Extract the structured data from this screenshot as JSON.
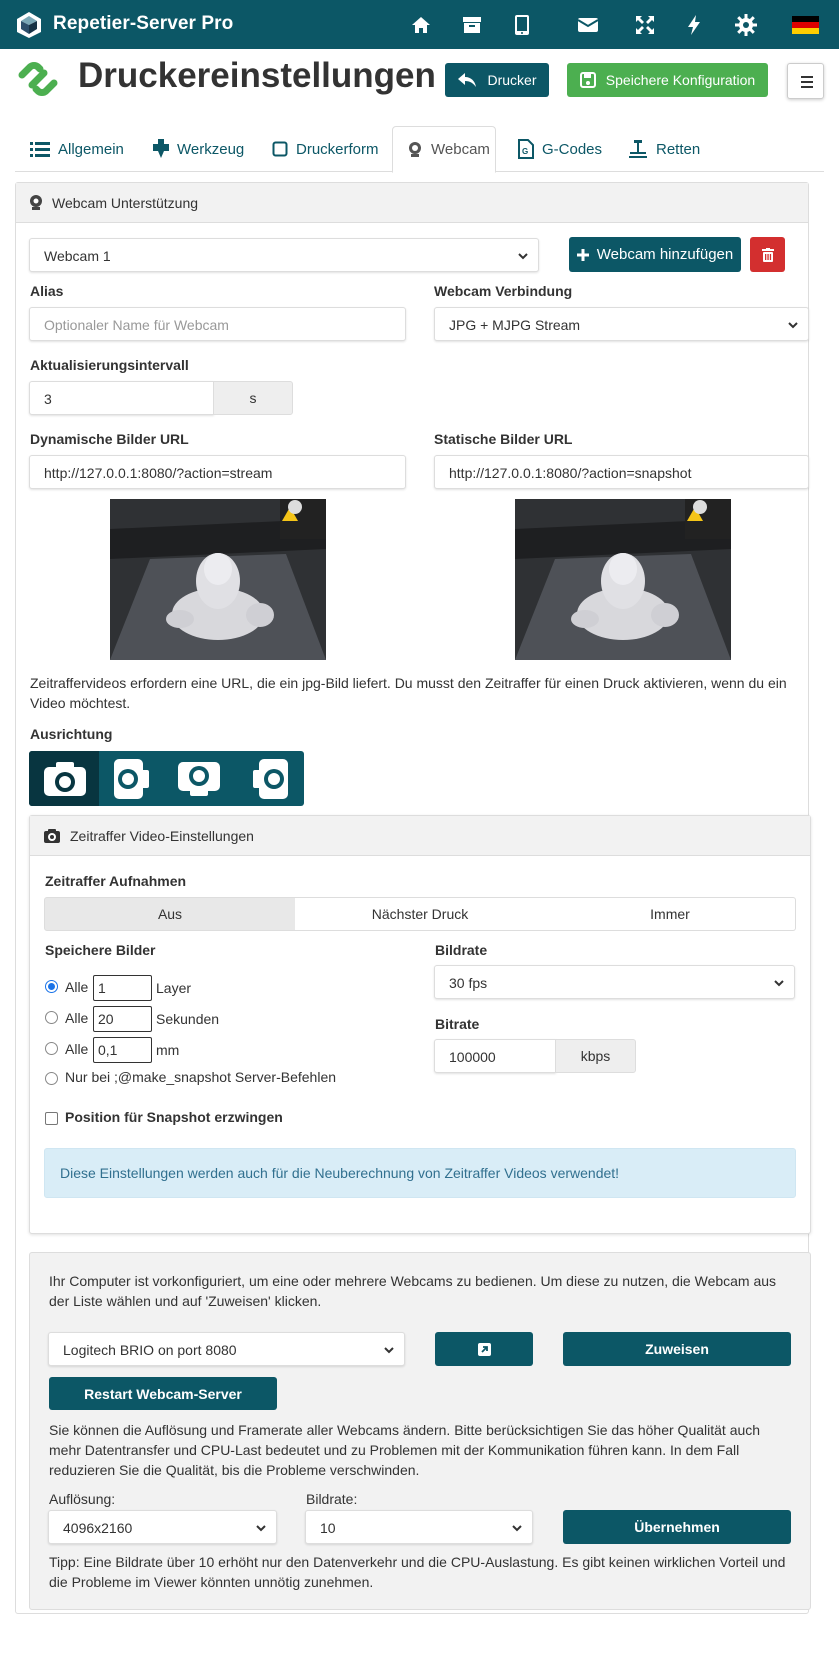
{
  "topbar": {
    "brand": "Repetier-Server Pro",
    "icons": [
      "home-icon",
      "archive-icon",
      "tablet-icon",
      "envelope-icon",
      "expand-icon",
      "bolt-icon",
      "gear-icon",
      "flag-de-icon"
    ],
    "color": "#0c5766"
  },
  "header": {
    "title": "Druckereinstellungen",
    "printer_button": "Drucker",
    "save_button": "Speichere Konfiguration"
  },
  "tabs": [
    {
      "label": "Allgemein",
      "icon": "list-icon"
    },
    {
      "label": "Werkzeug",
      "icon": "tool-icon"
    },
    {
      "label": "Druckerform",
      "icon": "square-icon"
    },
    {
      "label": "Webcam",
      "icon": "webcam-icon",
      "active": true
    },
    {
      "label": "G-Codes",
      "icon": "gcode-file-icon"
    },
    {
      "label": "Retten",
      "icon": "rescue-icon"
    }
  ],
  "webcam_panel": {
    "title": "Webcam Unterstützung",
    "webcam_select": "Webcam 1",
    "add_button": "Webcam hinzufügen",
    "alias_label": "Alias",
    "alias_placeholder": "Optionaler Name für Webcam",
    "connection_label": "Webcam Verbindung",
    "connection_value": "JPG + MJPG Stream",
    "interval_label": "Aktualisierungsintervall",
    "interval_value": "3",
    "interval_unit": "s",
    "dynamic_url_label": "Dynamische Bilder URL",
    "dynamic_url_value": "http://127.0.0.1:8080/?action=stream",
    "static_url_label": "Statische Bilder URL",
    "static_url_value": "http://127.0.0.1:8080/?action=snapshot",
    "timelapse_note": "Zeitraffervideos erfordern eine URL, die ein jpg-Bild liefert. Du musst den Zeitraffer für einen Druck aktivieren, wenn du ein Video möchtest.",
    "orientation_label": "Ausrichtung"
  },
  "timelapse": {
    "title": "Zeitraffer Video-Einstellungen",
    "captures_label": "Zeitraffer Aufnahmen",
    "options": [
      "Aus",
      "Nächster Druck",
      "Immer"
    ],
    "selected": "Aus",
    "save_images_label": "Speichere Bilder",
    "radio_prefix": "Alle",
    "every_layer_value": "1",
    "every_layer_unit": "Layer",
    "every_seconds_value": "20",
    "every_seconds_unit": "Sekunden",
    "every_mm_value": "0,1",
    "every_mm_unit": "mm",
    "only_on_label": "Nur bei ;@make_snapshot Server-Befehlen",
    "force_position_label": "Position für Snapshot erzwingen",
    "framerate_label": "Bildrate",
    "framerate_value": "30 fps",
    "bitrate_label": "Bitrate",
    "bitrate_value": "100000",
    "bitrate_unit": "kbps",
    "info": "Diese Einstellungen werden auch für die Neuberechnung von Zeitraffer Videos verwendet!"
  },
  "server_webcam": {
    "intro": "Ihr Computer ist vorkonfiguriert, um eine oder mehrere Webcams zu bedienen. Um diese zu nutzen, die Webcam aus der Liste wählen und auf 'Zuweisen' klicken.",
    "camera_select": "Logitech BRIO on port 8080",
    "assign_button": "Zuweisen",
    "restart_button": "Restart Webcam-Server",
    "quality_note": "Sie können die Auflösung und Framerate aller Webcams ändern. Bitte berücksichtigen Sie das höher Qualität auch mehr Datentransfer und CPU-Last bedeutet und zu Problemen mit der Kommunikation führen kann. In dem Fall reduzieren Sie die Qualität, bis die Probleme verschwinden.",
    "resolution_label": "Auflösung:",
    "resolution_value": "4096x2160",
    "framerate_label": "Bildrate:",
    "framerate_value": "10",
    "apply_button": "Übernehmen",
    "tip": "Tipp: Eine Bildrate über 10 erhöht nur den Datenverkehr und die CPU-Auslastung. Es gibt keinen wirklichen Vorteil und die Probleme im Viewer könnten unnötig zunehmen."
  }
}
